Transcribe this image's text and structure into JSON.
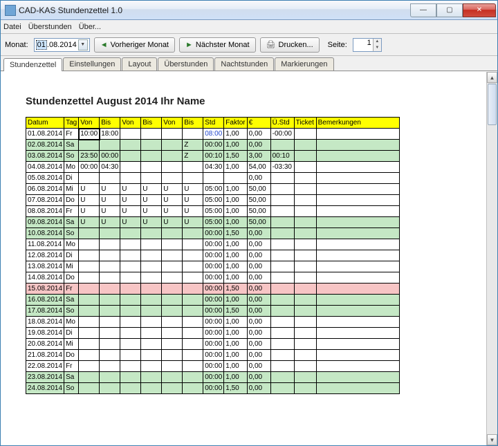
{
  "window": {
    "title": "CAD-KAS Stundenzettel 1.0"
  },
  "menu": [
    "Datei",
    "Überstunden",
    "Über..."
  ],
  "toolbar": {
    "month_label": "Monat:",
    "date_value": "01.08.2014",
    "date_sel_part": "01",
    "date_rest": ".08.2014",
    "prev_label": "Vorheriger Monat",
    "next_label": "Nächster Monat",
    "print_label": "Drucken...",
    "page_label": "Seite:",
    "page_value": "1"
  },
  "tabs": [
    "Stundenzettel",
    "Einstellungen",
    "Layout",
    "Überstunden",
    "Nachtstunden",
    "Markierungen"
  ],
  "sheet": {
    "title": "Stundenzettel August 2014 Ihr Name"
  },
  "headers": [
    "Datum",
    "Tag",
    "Von",
    "Bis",
    "Von",
    "Bis",
    "Von",
    "Bis",
    "Std",
    "Faktor",
    "€",
    "Ü.Std",
    "Ticket",
    "Bemerkungen"
  ],
  "rows": [
    {
      "cls": "",
      "d": "01.08.2014",
      "t": "Fr",
      "c": [
        "10:00",
        "18:00",
        "",
        "",
        "",
        "",
        "08:00",
        "1,00",
        "0,00",
        "-00:00",
        "",
        ""
      ],
      "active": 0,
      "stdblue": true
    },
    {
      "cls": "green",
      "d": "02.08.2014",
      "t": "Sa",
      "c": [
        "",
        "",
        "",
        "",
        "",
        "Z",
        "00:00",
        "1,00",
        "0,00",
        "",
        "",
        ""
      ]
    },
    {
      "cls": "green",
      "d": "03.08.2014",
      "t": "So",
      "c": [
        "23:50",
        "00:00",
        "",
        "",
        "",
        "Z",
        "00:10",
        "1,50",
        "3,00",
        "00:10",
        "",
        ""
      ]
    },
    {
      "cls": "",
      "d": "04.08.2014",
      "t": "Mo",
      "c": [
        "00:00",
        "04:30",
        "",
        "",
        "",
        "",
        "04:30",
        "1,00",
        "54,00",
        "-03:30",
        "",
        ""
      ]
    },
    {
      "cls": "",
      "d": "05.08.2014",
      "t": "Di",
      "c": [
        "",
        "",
        "",
        "",
        "",
        "",
        "",
        "",
        "0,00",
        "",
        "",
        ""
      ]
    },
    {
      "cls": "",
      "d": "06.08.2014",
      "t": "Mi",
      "c": [
        "U",
        "U",
        "U",
        "U",
        "U",
        "U",
        "05:00",
        "1,00",
        "50,00",
        "",
        "",
        ""
      ]
    },
    {
      "cls": "",
      "d": "07.08.2014",
      "t": "Do",
      "c": [
        "U",
        "U",
        "U",
        "U",
        "U",
        "U",
        "05:00",
        "1,00",
        "50,00",
        "",
        "",
        ""
      ]
    },
    {
      "cls": "",
      "d": "08.08.2014",
      "t": "Fr",
      "c": [
        "U",
        "U",
        "U",
        "U",
        "U",
        "U",
        "05:00",
        "1,00",
        "50,00",
        "",
        "",
        ""
      ]
    },
    {
      "cls": "green",
      "d": "09.08.2014",
      "t": "Sa",
      "c": [
        "U",
        "U",
        "U",
        "U",
        "U",
        "U",
        "05:00",
        "1,00",
        "50,00",
        "",
        "",
        ""
      ]
    },
    {
      "cls": "green",
      "d": "10.08.2014",
      "t": "So",
      "c": [
        "",
        "",
        "",
        "",
        "",
        "",
        "00:00",
        "1,50",
        "0,00",
        "",
        "",
        ""
      ]
    },
    {
      "cls": "",
      "d": "11.08.2014",
      "t": "Mo",
      "c": [
        "",
        "",
        "",
        "",
        "",
        "",
        "00:00",
        "1,00",
        "0,00",
        "",
        "",
        ""
      ]
    },
    {
      "cls": "",
      "d": "12.08.2014",
      "t": "Di",
      "c": [
        "",
        "",
        "",
        "",
        "",
        "",
        "00:00",
        "1,00",
        "0,00",
        "",
        "",
        ""
      ]
    },
    {
      "cls": "",
      "d": "13.08.2014",
      "t": "Mi",
      "c": [
        "",
        "",
        "",
        "",
        "",
        "",
        "00:00",
        "1,00",
        "0,00",
        "",
        "",
        ""
      ]
    },
    {
      "cls": "",
      "d": "14.08.2014",
      "t": "Do",
      "c": [
        "",
        "",
        "",
        "",
        "",
        "",
        "00:00",
        "1,00",
        "0,00",
        "",
        "",
        ""
      ]
    },
    {
      "cls": "pink",
      "d": "15.08.2014",
      "t": "Fr",
      "c": [
        "",
        "",
        "",
        "",
        "",
        "",
        "00:00",
        "1,50",
        "0,00",
        "",
        "",
        ""
      ]
    },
    {
      "cls": "green",
      "d": "16.08.2014",
      "t": "Sa",
      "c": [
        "",
        "",
        "",
        "",
        "",
        "",
        "00:00",
        "1,00",
        "0,00",
        "",
        "",
        ""
      ]
    },
    {
      "cls": "green",
      "d": "17.08.2014",
      "t": "So",
      "c": [
        "",
        "",
        "",
        "",
        "",
        "",
        "00:00",
        "1,50",
        "0,00",
        "",
        "",
        ""
      ]
    },
    {
      "cls": "",
      "d": "18.08.2014",
      "t": "Mo",
      "c": [
        "",
        "",
        "",
        "",
        "",
        "",
        "00:00",
        "1,00",
        "0,00",
        "",
        "",
        ""
      ]
    },
    {
      "cls": "",
      "d": "19.08.2014",
      "t": "Di",
      "c": [
        "",
        "",
        "",
        "",
        "",
        "",
        "00:00",
        "1,00",
        "0,00",
        "",
        "",
        ""
      ]
    },
    {
      "cls": "",
      "d": "20.08.2014",
      "t": "Mi",
      "c": [
        "",
        "",
        "",
        "",
        "",
        "",
        "00:00",
        "1,00",
        "0,00",
        "",
        "",
        ""
      ]
    },
    {
      "cls": "",
      "d": "21.08.2014",
      "t": "Do",
      "c": [
        "",
        "",
        "",
        "",
        "",
        "",
        "00:00",
        "1,00",
        "0,00",
        "",
        "",
        ""
      ]
    },
    {
      "cls": "",
      "d": "22.08.2014",
      "t": "Fr",
      "c": [
        "",
        "",
        "",
        "",
        "",
        "",
        "00:00",
        "1,00",
        "0,00",
        "",
        "",
        ""
      ]
    },
    {
      "cls": "green",
      "d": "23.08.2014",
      "t": "Sa",
      "c": [
        "",
        "",
        "",
        "",
        "",
        "",
        "00:00",
        "1,00",
        "0,00",
        "",
        "",
        ""
      ]
    },
    {
      "cls": "green",
      "d": "24.08.2014",
      "t": "So",
      "c": [
        "",
        "",
        "",
        "",
        "",
        "",
        "00:00",
        "1,50",
        "0,00",
        "",
        "",
        ""
      ]
    }
  ]
}
